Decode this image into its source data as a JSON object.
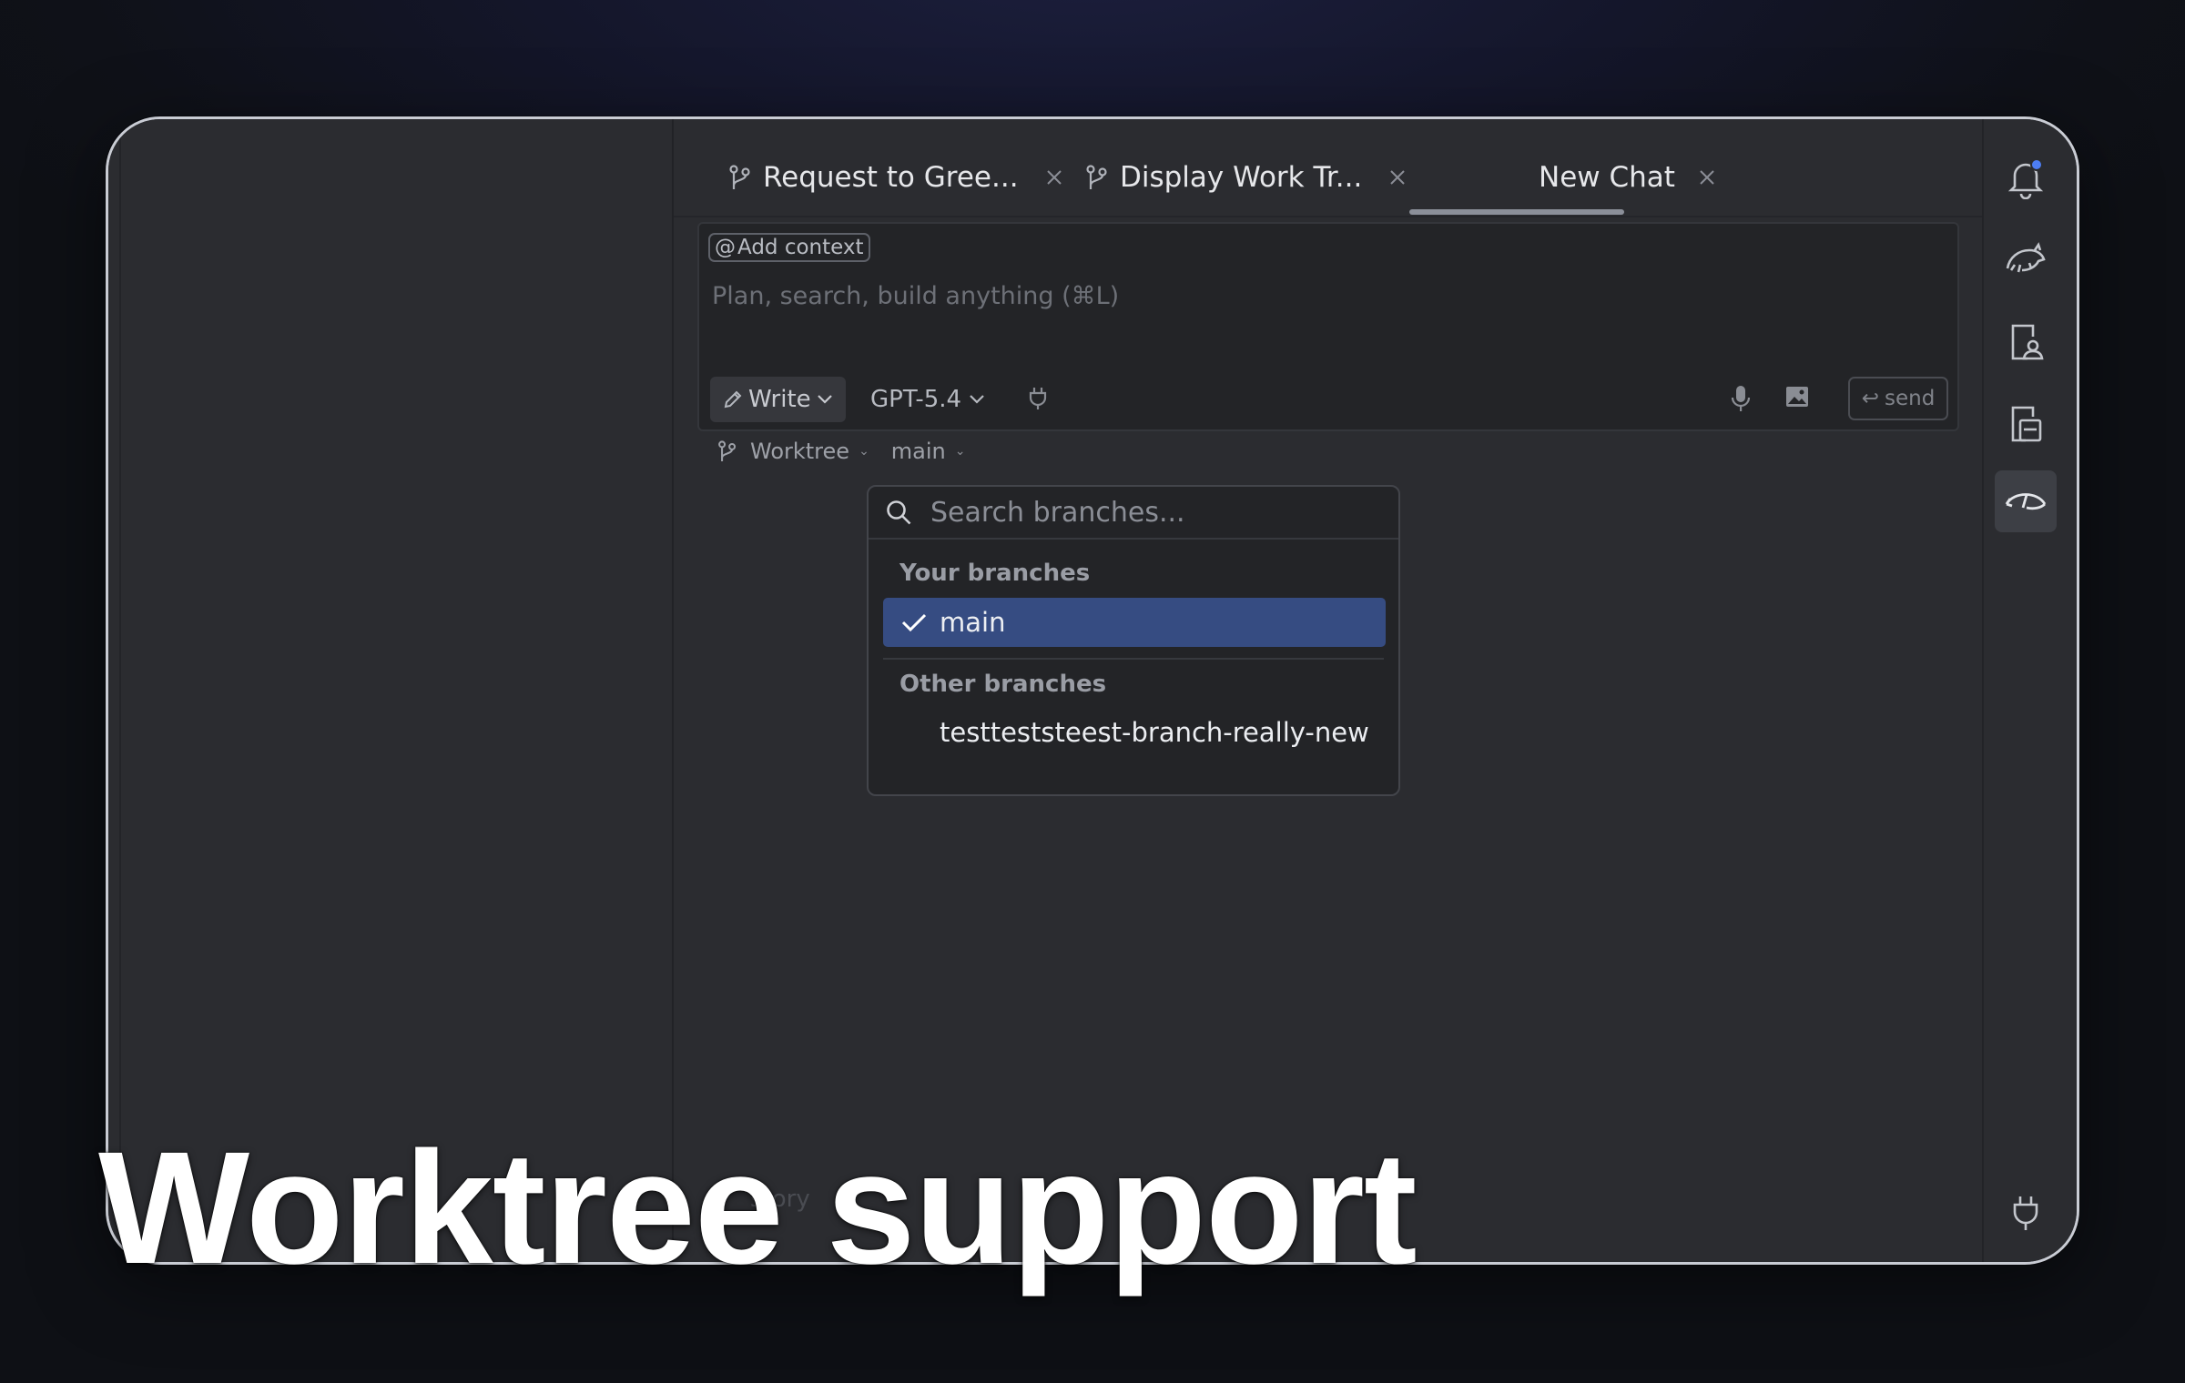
{
  "tabs": [
    {
      "label": "Request to Gree...",
      "icon": "git-branch-icon"
    },
    {
      "label": "Display Work Tr...",
      "icon": "git-branch-icon"
    },
    {
      "label": "New Chat",
      "active": true
    }
  ],
  "composer": {
    "add_context": "Add context",
    "placeholder": "Plan, search, build anything (⌘L)",
    "mode": "Write",
    "model": "GPT-5.4",
    "send_label": "send"
  },
  "worktree": {
    "label": "Worktree",
    "branch": "main"
  },
  "branch_dropdown": {
    "search_placeholder": "Search branches...",
    "your_branches_heading": "Your branches",
    "your_branches": [
      {
        "name": "main",
        "selected": true
      }
    ],
    "other_branches_heading": "Other branches",
    "other_branches": [
      {
        "name": "testteststeest-branch-really-new"
      }
    ]
  },
  "background_hint": "story",
  "headline": "Worktree support",
  "colors": {
    "selected_item": "#364c82",
    "notification_dot": "#4d7ef5"
  }
}
